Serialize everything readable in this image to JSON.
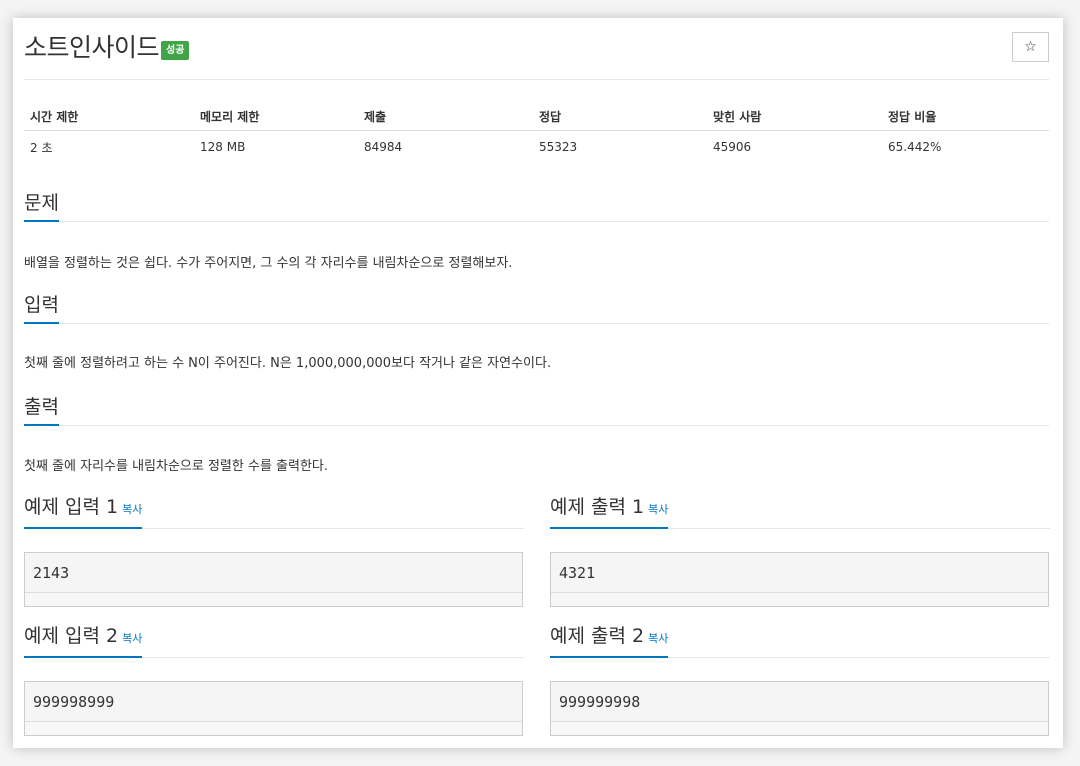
{
  "problem": {
    "title": "소트인사이드",
    "badge": "성공",
    "star": "☆"
  },
  "stats": {
    "headers": [
      "시간 제한",
      "메모리 제한",
      "제출",
      "정답",
      "맞힌 사람",
      "정답 비율"
    ],
    "values": [
      "2 초",
      "128 MB",
      "84984",
      "55323",
      "45906",
      "65.442%"
    ]
  },
  "sections": {
    "description_title": "문제",
    "description_text": "배열을 정렬하는 것은 쉽다. 수가 주어지면, 그 수의 각 자리수를 내림차순으로 정렬해보자.",
    "input_title": "입력",
    "input_text": "첫째 줄에 정렬하려고 하는 수 N이 주어진다. N은 1,000,000,000보다 작거나 같은 자연수이다.",
    "output_title": "출력",
    "output_text": "첫째 줄에 자리수를 내림차순으로 정렬한 수를 출력한다."
  },
  "samples": {
    "copy_label": "복사",
    "input1_title": "예제 입력 1",
    "output1_title": "예제 출력 1",
    "input1_value": "2143",
    "output1_value": "4321",
    "input2_title": "예제 입력 2",
    "output2_title": "예제 출력 2",
    "input2_value": "999998999",
    "output2_value": "999999998"
  },
  "colors": {
    "accent": "#0076c0",
    "badge": "#40a547"
  }
}
